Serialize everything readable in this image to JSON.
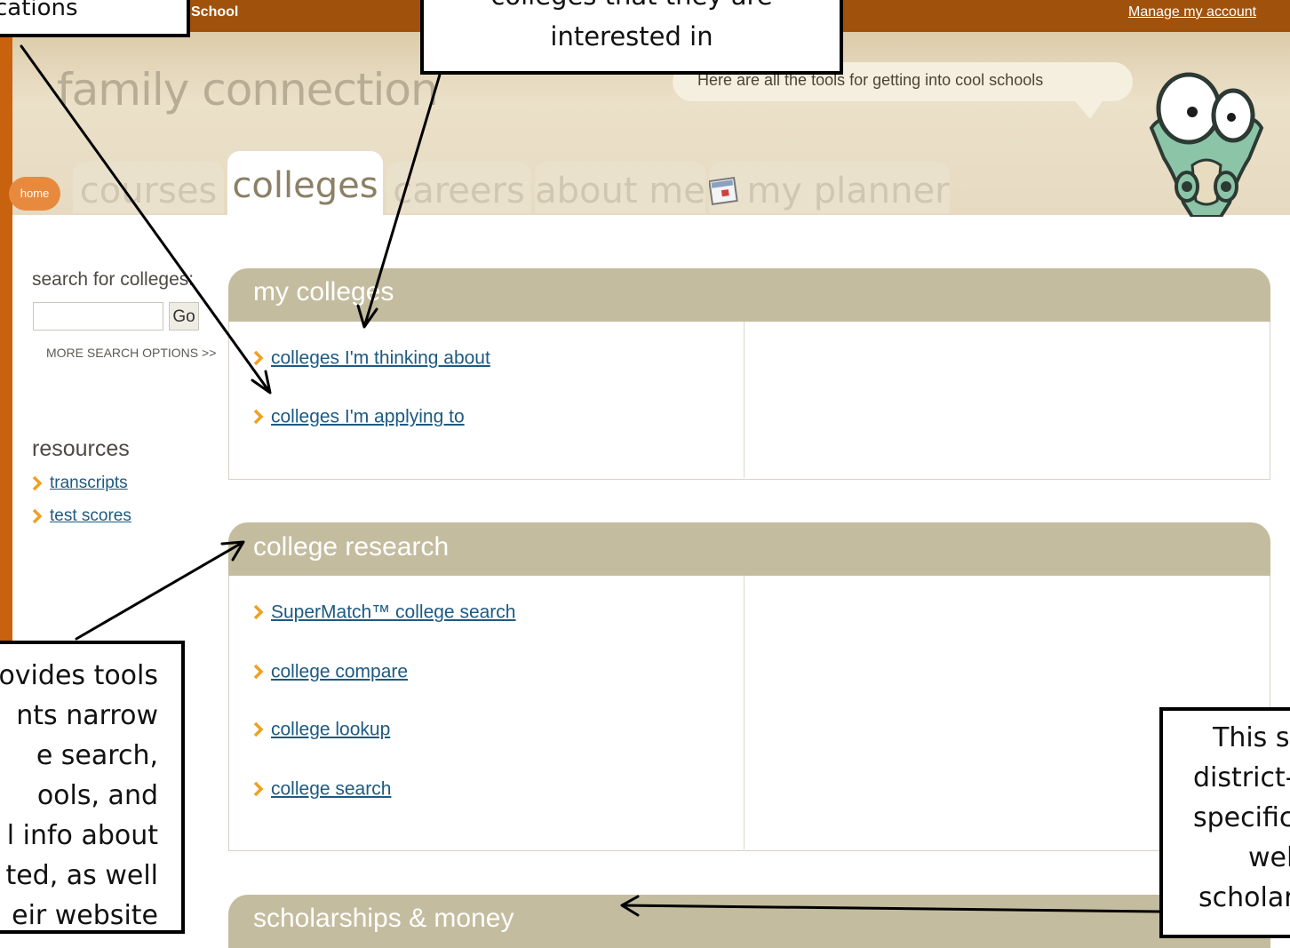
{
  "topbar": {
    "school_label": "School",
    "manage_account": "Manage my account"
  },
  "header": {
    "brand": "family connection",
    "tagline": "Here are all the tools for getting into cool schools"
  },
  "nav": {
    "home": "home",
    "tabs": [
      "courses",
      "colleges",
      "careers",
      "about me",
      "my planner"
    ],
    "active_tab": "colleges"
  },
  "sidebar": {
    "search_label": "search for colleges:",
    "search_value": "",
    "go_button": "Go",
    "more_options": "MORE SEARCH OPTIONS >>",
    "resources_title": "resources",
    "resources": [
      "transcripts",
      "test scores"
    ]
  },
  "panels": {
    "my_colleges": {
      "title": "my colleges",
      "links": [
        "colleges I'm thinking about",
        "colleges I'm applying to"
      ]
    },
    "college_research": {
      "title": "college research",
      "links": [
        "SuperMatch™ college search",
        "college compare",
        "college lookup",
        "college search"
      ]
    },
    "scholarships": {
      "title": "scholarships & money"
    }
  },
  "annotations": {
    "top_left": [
      "cations"
    ],
    "top_center": [
      "colleges that they are",
      "interested in"
    ],
    "bottom_left": [
      "ovides tools",
      "nts narrow",
      "e search,",
      "ools, and",
      "l info about",
      "ted, as well",
      "eir website"
    ],
    "bottom_right": [
      "This se",
      "district-",
      "specific",
      "wel",
      "scholar"
    ]
  },
  "colors": {
    "topbar": "#a0520c",
    "panel_header": "#c4bc9f",
    "link": "#1d5a82",
    "chevron": "#f0a020",
    "home_button": "#e88a3e"
  }
}
